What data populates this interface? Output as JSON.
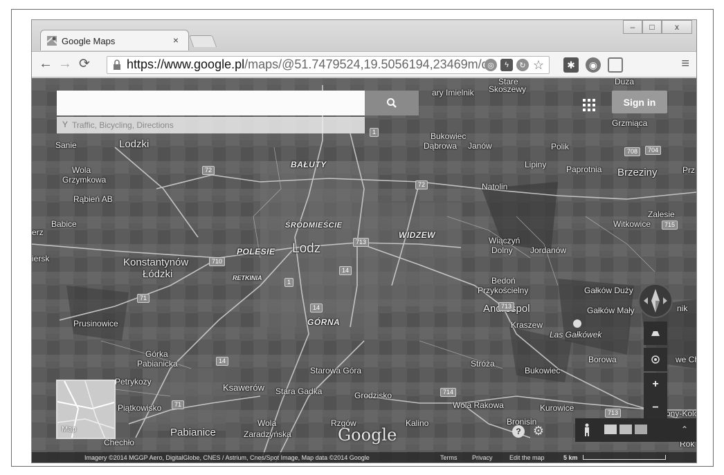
{
  "browser": {
    "tab_title": "Google Maps",
    "tab_close": "×",
    "window_buttons": {
      "minimize": "–",
      "maximize": "□",
      "close": "x"
    },
    "url_host": "https://www.google.pl",
    "url_path": "/maps/@51.7479524,19.5056194,23469m/data=!3"
  },
  "maps": {
    "search_placeholder": "",
    "hint": "Traffic, Bicycling, Directions",
    "sign_in": "Sign in",
    "minimap_label": "Map",
    "google_logo": "Google",
    "labels": {
      "duza": "Duza",
      "stare_skoszewy_1": "Stare",
      "stare_skoszewy_2": "Skoszewy",
      "ary_imielnik": "ary Imielnik",
      "grzmiaca": "Grzmiąca",
      "sanie": "Sanie",
      "lodzki": "Lodzki",
      "bukowiec": "Bukowiec",
      "dabrowa": "Dąbrowa",
      "janow": "Janów",
      "polik": "Polik",
      "baluty": "BAŁUTY",
      "wola_grzymkowa_1": "Wola",
      "wola_grzymkowa_2": "Grzymkowa",
      "lipiny": "Lipiny",
      "paprotnia": "Paprotnia",
      "brzeziny": "Brzeziny",
      "przy": "Prz",
      "natolin": "Natolin",
      "rabien": "Rąbień AB",
      "zalesie": "Zalesie",
      "witkowice": "Witkowice",
      "babice": "Babice",
      "srodmiescie": "ŚRÓDMIEŚCIE",
      "widzew": "WIDZEW",
      "erz": "erz",
      "polesie": "POLESIE",
      "lodz": "Lodz",
      "wiaczyn_1": "Wiączyń",
      "wiaczyn_2": "Dolny",
      "jordanow": "Jordanów",
      "iersk": "iersk",
      "konstantynow_1": "Konstantynów",
      "konstantynow_2": "Łódzki",
      "retkinia": "RETKINIA",
      "bedon_1": "Bedoń",
      "bedon_2": "Przykościelny",
      "galkow_duzy": "Gałków Duży",
      "nik": "nik",
      "andrespol": "Andrespol",
      "galkow_maly": "Gałków Mały",
      "prusinowice": "Prusinowice",
      "gorna": "GÓRNA",
      "kraszew": "Kraszew",
      "las_galkowek": "Las Gałkówek",
      "gorka_1": "Górka",
      "gorka_2": "Pabianicka",
      "borowa": "Borowa",
      "we_ch": "we Ch",
      "starowa_gora": "Starowa Góra",
      "stroza": "Stróża",
      "bukowiec2": "Bukowiec",
      "petrykozy": "Petrykozy",
      "ksawerow": "Ksawerów",
      "stara_gadka": "Stara Gadka",
      "grodzisko": "Grodzisko",
      "wola_rakowa": "Wola Rakowa",
      "kurowice": "Kurowice",
      "piatkowisko": "Piątkowisko",
      "bronisin": "Bronisin",
      "rzgow": "Rzgów",
      "kalino": "Kalino",
      "wola_zaradzynska_1": "Wola",
      "wola_zaradzynska_2": "Zaradzyńska",
      "pabianice": "Pabianice",
      "chechlo": "Chechło",
      "rok": "Rok",
      "bronow_kol": "Brony-Kolo",
      "ksawerow_2": ""
    },
    "road_shields": [
      "1",
      "72",
      "72",
      "708",
      "704",
      "715",
      "713",
      "710",
      "14",
      "14",
      "71",
      "14",
      "713",
      "71",
      "714",
      "713",
      "1"
    ],
    "footer": {
      "imagery": "Imagery ©2014 MGGP Aero, DigitalGlobe, CNES / Astrium, Cnes/Spot Image, Map data ©2014 Google",
      "terms": "Terms",
      "privacy": "Privacy",
      "edit": "Edit the map",
      "scale": "5 km"
    }
  },
  "colors": {
    "satellite_base": "#5a5a5a",
    "road": "#cfcfcf",
    "label": "#f2f2f2"
  }
}
